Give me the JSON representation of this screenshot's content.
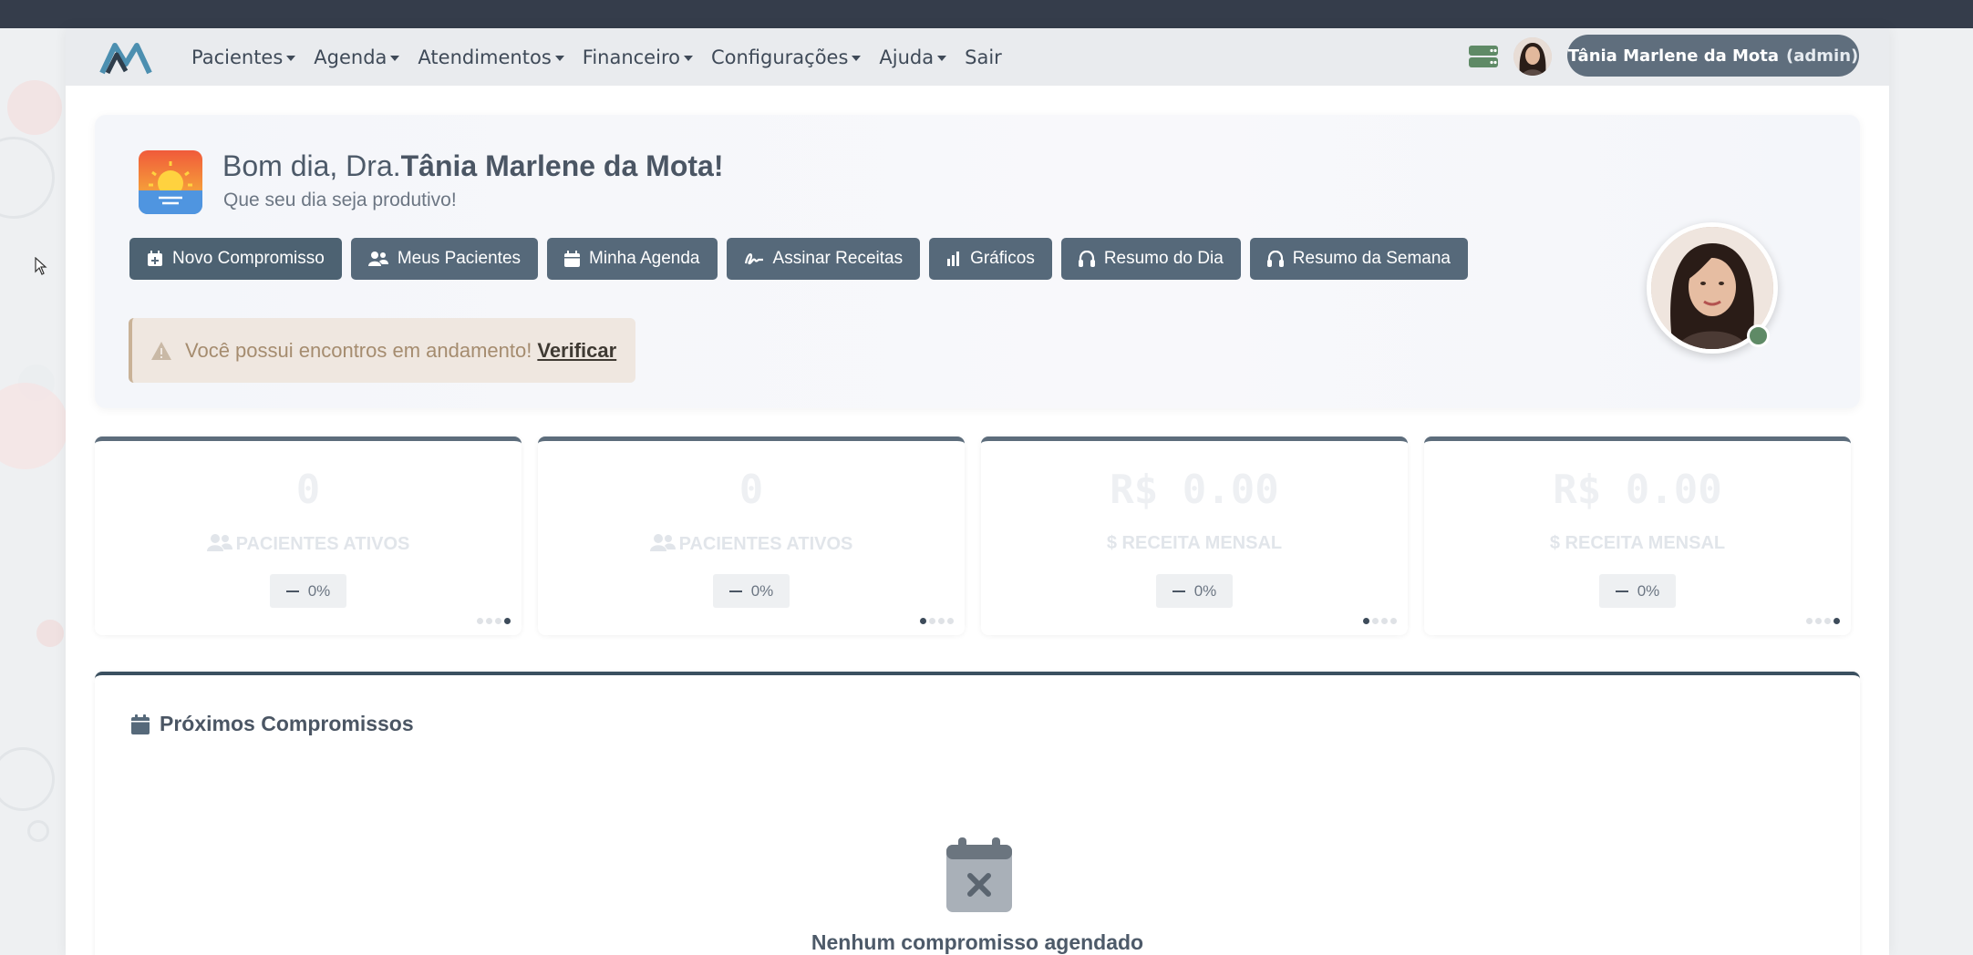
{
  "navbar": {
    "menu": [
      {
        "label": "Pacientes",
        "dropdown": true
      },
      {
        "label": "Agenda",
        "dropdown": true
      },
      {
        "label": "Atendimentos",
        "dropdown": true
      },
      {
        "label": "Financeiro",
        "dropdown": true
      },
      {
        "label": "Configurações",
        "dropdown": true
      },
      {
        "label": "Ajuda",
        "dropdown": true
      },
      {
        "label": "Sair",
        "dropdown": false
      }
    ],
    "user_name": "Tânia Marlene da Mota",
    "user_role": "(admin)"
  },
  "welcome": {
    "greeting_prefix": "Bom dia, Dra.",
    "greeting_name": "Tânia Marlene da Mota!",
    "subtitle": "Que seu dia seja produtivo!",
    "actions": [
      {
        "label": "Novo Compromisso",
        "icon": "calendar-plus-icon"
      },
      {
        "label": "Meus Pacientes",
        "icon": "users-icon"
      },
      {
        "label": "Minha Agenda",
        "icon": "calendar-icon"
      },
      {
        "label": "Assinar Receitas",
        "icon": "signature-icon"
      },
      {
        "label": "Gráficos",
        "icon": "bar-chart-icon"
      },
      {
        "label": "Resumo do Dia",
        "icon": "headphones-icon"
      },
      {
        "label": "Resumo da Semana",
        "icon": "headphones-icon"
      }
    ],
    "alert_text": "Você possui encontros em andamento!",
    "alert_link": "Verificar"
  },
  "stats": [
    {
      "value": "0",
      "label": "PACIENTES ATIVOS",
      "icon": "users-icon",
      "delta": "0%",
      "active_dot": 3
    },
    {
      "value": "0",
      "label": "PACIENTES ATIVOS",
      "icon": "users-icon",
      "delta": "0%",
      "active_dot": 0
    },
    {
      "value": "R$ 0.00",
      "label": "$ RECEITA MENSAL",
      "icon": "dollar-icon",
      "delta": "0%",
      "active_dot": 0
    },
    {
      "value": "R$ 0.00",
      "label": "$ RECEITA MENSAL",
      "icon": "dollar-icon",
      "delta": "0%",
      "active_dot": 3
    }
  ],
  "appointments": {
    "title": "Próximos Compromissos",
    "empty_text": "Nenhum compromisso agendado"
  },
  "colors": {
    "topbar": "#353d4b",
    "navbar": "#e9ebee",
    "button": "#56697a",
    "online": "#5f8a66"
  }
}
